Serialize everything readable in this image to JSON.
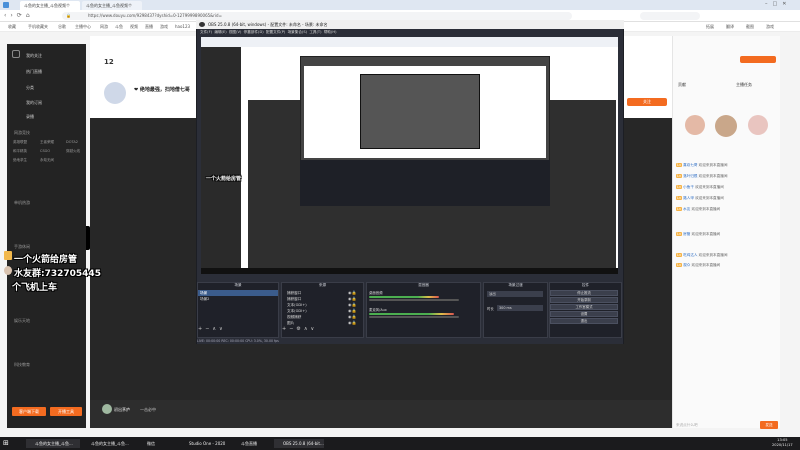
{
  "browser": {
    "tabs": [
      "斗鱼的女主播_斗鱼视频个",
      "斗鱼的女主播_斗鱼视频个"
    ],
    "url": "https://www.douyu.com/9298437?dyshid=0-1279999890065&rid=",
    "bookmarks": [
      "收藏",
      "手机收藏夹",
      "谷歌",
      "主播中心",
      "网游",
      "斗鱼",
      "视频",
      "直播",
      "游戏",
      "hao123",
      "网购"
    ],
    "right_bookmarks": [
      "拓展",
      "翻译",
      "截图",
      "游戏"
    ]
  },
  "sidebar": {
    "items": [
      "我的关注",
      "热门直播",
      "分类",
      "我的订阅",
      "录播"
    ],
    "sections": [
      "网游竞技",
      "单机热游",
      "手游休闲",
      "娱乐天地",
      "科技教育"
    ],
    "games": [
      "英雄联盟",
      "王者荣耀",
      "DOTA2",
      "和平精英",
      "CSGO",
      "穿越火线",
      "绝地求生",
      "永劫无间"
    ],
    "bottom_buttons": [
      "客户端下载",
      "开播工具"
    ]
  },
  "overlay_text": {
    "line1": "一个火箭给房管",
    "line2": "水友群:732705445",
    "line3": "个飞机上车"
  },
  "stream_header": {
    "title": "❤ 绝地最强，扫地僧七哥",
    "follow_label": "关注",
    "count": "12"
  },
  "obs": {
    "title": "OBS 25.0.8 (64-bit, windows) - 配置文件: 未命名 - 场景: 未命名",
    "menu": [
      "文件(F)",
      "编辑(E)",
      "视图(V)",
      "停靠部件(D)",
      "配置文件(P)",
      "场景集合(S)",
      "工具(T)",
      "帮助(H)"
    ],
    "dock_titles": [
      "场景",
      "来源",
      "混音器",
      "场景过渡",
      "控件"
    ],
    "scenes": [
      "场景",
      "场景2"
    ],
    "sources": [
      "捕获窗口",
      "捕获窗口",
      "文本(GDI+)",
      "文本(GDI+)",
      "视频捕获",
      "图片"
    ],
    "mixer": [
      "桌面音频",
      "麦克风/Aux"
    ],
    "transition": {
      "type": "淡出",
      "duration_label": "时长",
      "duration": "300 ms"
    },
    "controls": [
      "停止推流",
      "开始录制",
      "工作室模式",
      "设置",
      "退出"
    ],
    "status": "LIVE: 00:00:00   REC: 00:00:00   CPU: 3.0%, 30.00 fps"
  },
  "chat": {
    "header": [
      "贡献",
      "主播任务"
    ],
    "messages": [
      {
        "user": "喜欢七哥",
        "text": "欢迎来到本直播间"
      },
      {
        "user": "落叶归根",
        "text": "欢迎来到本直播间"
      },
      {
        "user": "小鱼干",
        "text": "欢迎来到本直播间"
      },
      {
        "user": "路人甲",
        "text": "欢迎来到本直播间"
      },
      {
        "user": "水友",
        "text": "欢迎来到本直播间"
      },
      {
        "user": "房管",
        "text": "欢迎来到本直播间"
      },
      {
        "user": "吃鸡达人",
        "text": "欢迎来到本直播间"
      },
      {
        "user": "观众",
        "text": "欢迎来到本直播间"
      }
    ],
    "input_placeholder": "来说点什么吧",
    "send_label": "发送"
  },
  "bottom_bar": {
    "label": "初出茅庐",
    "sub": "一击必中"
  },
  "taskbar": {
    "items": [
      "斗鱼的女主播_斗鱼...",
      "斗鱼的女主播_斗鱼...",
      "微信",
      "Studio One - 2020",
      "斗鱼直播",
      "OBS 25.0.8 (64-bit..."
    ],
    "time": "13:05",
    "date": "2020/11/17"
  }
}
